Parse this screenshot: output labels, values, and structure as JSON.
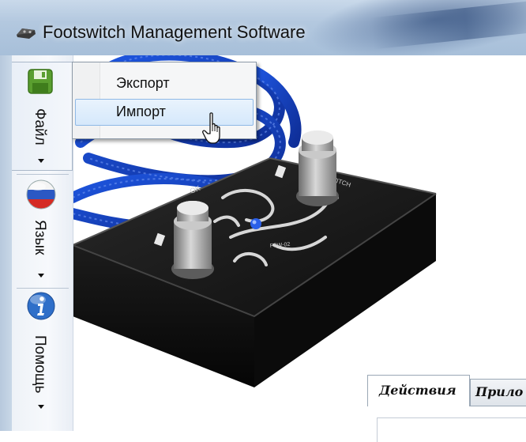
{
  "window": {
    "title": "Footswitch Management Software",
    "icon": "footswitch-app-icon"
  },
  "toolbar": {
    "items": [
      {
        "label": "Файл",
        "icon": "floppy-disk-icon",
        "has_dropdown": true
      },
      {
        "label": "Язык",
        "icon": "russian-flag-icon",
        "has_dropdown": true
      },
      {
        "label": "Помощь",
        "icon": "info-icon",
        "has_dropdown": true
      }
    ]
  },
  "file_menu": {
    "open": true,
    "items": [
      {
        "label": "Экспорт",
        "highlighted": false
      },
      {
        "label": "Импорт",
        "highlighted": true
      }
    ]
  },
  "tabs": [
    {
      "label": "Действия",
      "active": true
    },
    {
      "label": "Прило",
      "active": false
    }
  ],
  "colors": {
    "menu_highlight": "#d5e8fb",
    "floppy_green": "#5a9e2f",
    "info_blue": "#2f6fc9",
    "cable_blue": "#1c4fd1"
  }
}
